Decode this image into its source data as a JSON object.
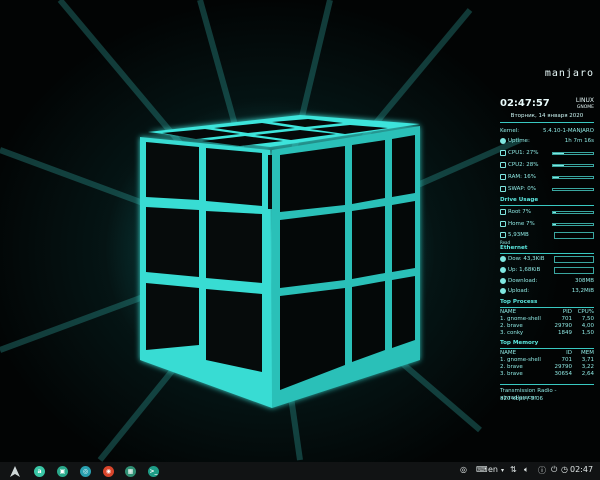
{
  "conky": {
    "logo": "manjaro",
    "clock": "02:47:57",
    "os_name": "LINUX",
    "os_desktop": "GNOME",
    "date": "Вторник, 14 января 2020",
    "kernel_label": "Kernel:",
    "kernel_value": "5.4.10-1-MANJARO",
    "uptime_label": "Uptime:",
    "uptime_value": "1h 7m 16s",
    "cpu1_label": "CPU1: 27%",
    "cpu1_pct": 27,
    "cpu2_label": "CPU2: 28%",
    "cpu2_pct": 28,
    "ram_label": "RAM: 16%",
    "ram_pct": 16,
    "swap_label": "SWAP: 0%",
    "swap_pct": 0,
    "drive_title": "Drive Usage",
    "root_label": "Root 7%",
    "root_pct": 7,
    "home_label": "Home 7%",
    "home_pct": 7,
    "disk_label": "5,93MB",
    "disk_sub": "Read",
    "eth_title": "Ethernet",
    "down_label": "Dow: 43,3KiB",
    "up_label": "Up: 1,68KiB",
    "download_label": "Download:",
    "download_value": "308MB",
    "upload_label": "Upload:",
    "upload_value": "13,2MiB",
    "proc_title": "Top Process",
    "proc_headers": [
      "NAME",
      "PID",
      "CPU%"
    ],
    "proc_rows": [
      [
        "1. gnome-shell",
        "701",
        "7,50"
      ],
      [
        "2. brave",
        "29790",
        "4,00"
      ],
      [
        "3. conky",
        "1849",
        "1,50"
      ]
    ],
    "mem_title": "Top Memory",
    "mem_headers": [
      "NAME",
      "ID",
      "MEM"
    ],
    "mem_rows": [
      [
        "1. gnome-shell",
        "701",
        "3,71"
      ],
      [
        "2. brave",
        "29790",
        "3,22"
      ],
      [
        "3. brave",
        "30654",
        "2,64"
      ]
    ],
    "radio_title": "Transmission Radio - air.radiorecor",
    "radio_rate": "320 kbps / 3:06"
  },
  "taskbar": {
    "lang": "en",
    "clock": "02:47",
    "apps": [
      {
        "glyph": "A",
        "color": "#cfd8d8"
      },
      {
        "glyph": "a",
        "color": "#39c6a5"
      },
      {
        "glyph": "▣",
        "color": "#2aa88a"
      },
      {
        "glyph": "◎",
        "color": "#29a0b0"
      },
      {
        "glyph": "◉",
        "color": "#d9452b"
      },
      {
        "glyph": "▦",
        "color": "#2f8f73"
      },
      {
        "glyph": ">_",
        "color": "#1e9c86"
      }
    ]
  },
  "colors": {
    "accent": "#3ce4db",
    "panel": "#111314"
  }
}
